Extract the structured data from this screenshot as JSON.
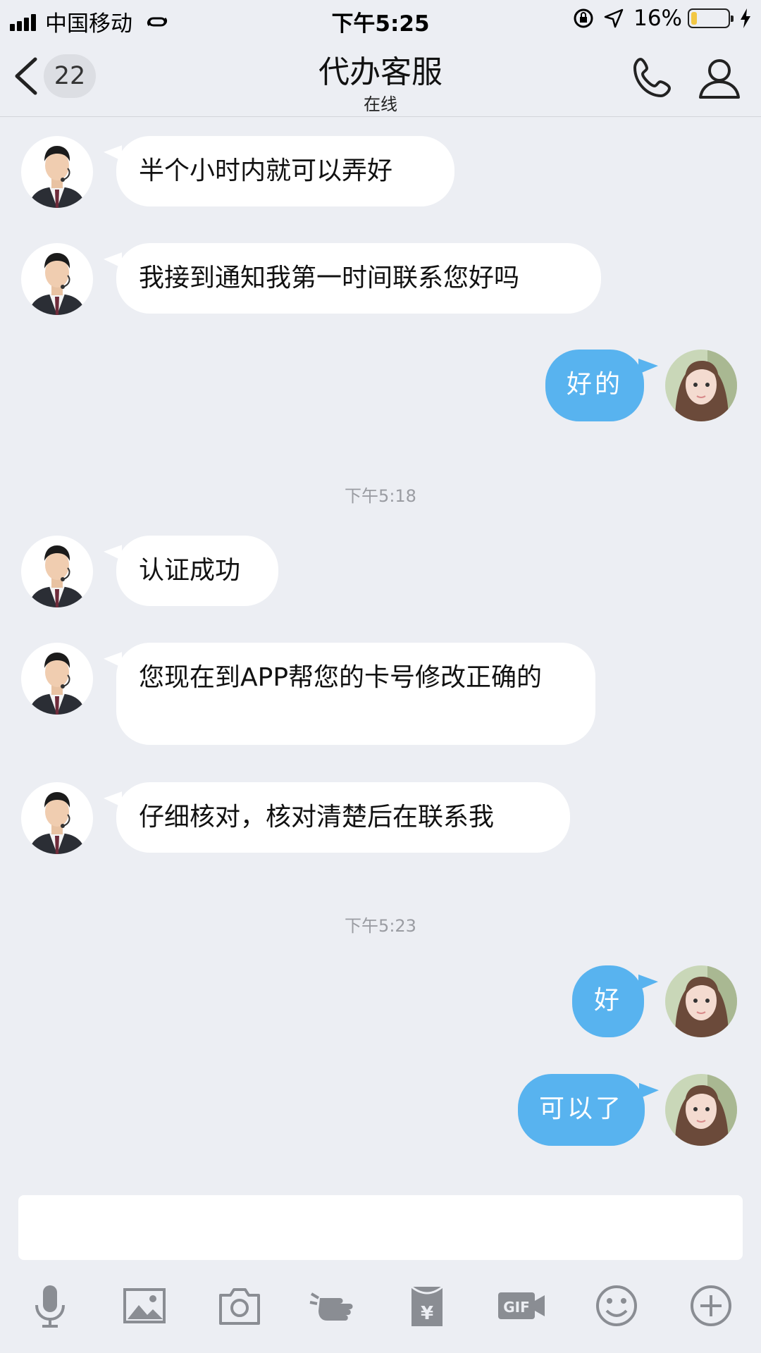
{
  "status_bar": {
    "carrier": "中国移动",
    "time": "下午5:25",
    "battery": "16%",
    "battery_level": 0.16
  },
  "nav": {
    "unread_count": "22",
    "title": "代办客服",
    "subtitle": "在线"
  },
  "messages": [
    {
      "from": "agent",
      "text": "半个小时内就可以弄好"
    },
    {
      "from": "agent",
      "text": "我接到通知我第一时间联系您好吗"
    },
    {
      "from": "user",
      "text": "好的"
    },
    {
      "from": "timestamp",
      "text": "下午5:18"
    },
    {
      "from": "agent",
      "text": "认证成功"
    },
    {
      "from": "agent",
      "text": "您现在到APP帮您的卡号修改正确的"
    },
    {
      "from": "agent",
      "text": "仔细核对，核对清楚后在联系我"
    },
    {
      "from": "timestamp",
      "text": "下午5:23"
    },
    {
      "from": "user",
      "text": "好"
    },
    {
      "from": "user",
      "text": "可以了"
    }
  ],
  "toolbar": {
    "items": [
      "microphone-icon",
      "image-icon",
      "camera-icon",
      "poke-icon",
      "red-packet-icon",
      "gif-icon",
      "emoji-icon",
      "plus-icon"
    ],
    "gif_label": "GIF",
    "red_packet_label": "¥"
  },
  "colors": {
    "background": "#eceef3",
    "bubble_out": "#58b3ef",
    "bubble_in": "#ffffff",
    "icon": "#8a8d93"
  }
}
